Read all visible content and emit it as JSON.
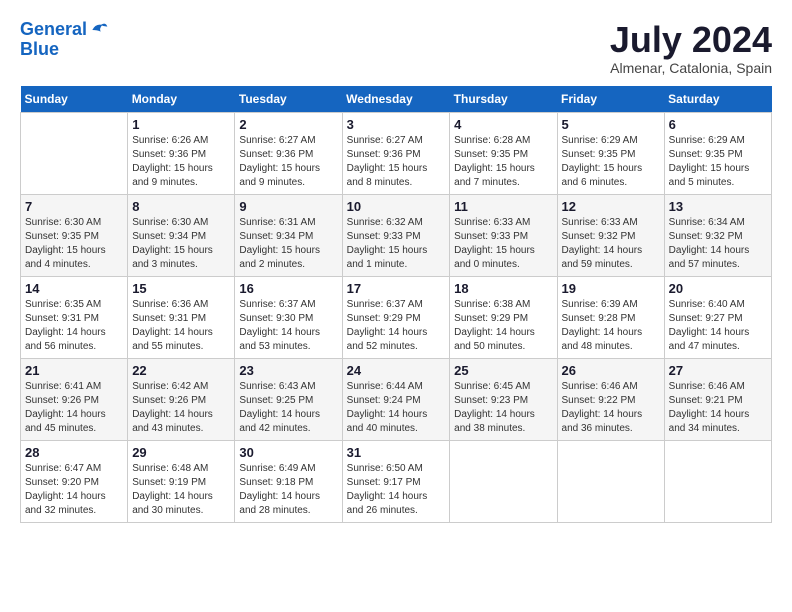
{
  "header": {
    "logo_line1": "General",
    "logo_line2": "Blue",
    "month_year": "July 2024",
    "location": "Almenar, Catalonia, Spain"
  },
  "days_of_week": [
    "Sunday",
    "Monday",
    "Tuesday",
    "Wednesday",
    "Thursday",
    "Friday",
    "Saturday"
  ],
  "weeks": [
    [
      {
        "day": "",
        "info": ""
      },
      {
        "day": "1",
        "info": "Sunrise: 6:26 AM\nSunset: 9:36 PM\nDaylight: 15 hours\nand 9 minutes."
      },
      {
        "day": "2",
        "info": "Sunrise: 6:27 AM\nSunset: 9:36 PM\nDaylight: 15 hours\nand 9 minutes."
      },
      {
        "day": "3",
        "info": "Sunrise: 6:27 AM\nSunset: 9:36 PM\nDaylight: 15 hours\nand 8 minutes."
      },
      {
        "day": "4",
        "info": "Sunrise: 6:28 AM\nSunset: 9:35 PM\nDaylight: 15 hours\nand 7 minutes."
      },
      {
        "day": "5",
        "info": "Sunrise: 6:29 AM\nSunset: 9:35 PM\nDaylight: 15 hours\nand 6 minutes."
      },
      {
        "day": "6",
        "info": "Sunrise: 6:29 AM\nSunset: 9:35 PM\nDaylight: 15 hours\nand 5 minutes."
      }
    ],
    [
      {
        "day": "7",
        "info": "Sunrise: 6:30 AM\nSunset: 9:35 PM\nDaylight: 15 hours\nand 4 minutes."
      },
      {
        "day": "8",
        "info": "Sunrise: 6:30 AM\nSunset: 9:34 PM\nDaylight: 15 hours\nand 3 minutes."
      },
      {
        "day": "9",
        "info": "Sunrise: 6:31 AM\nSunset: 9:34 PM\nDaylight: 15 hours\nand 2 minutes."
      },
      {
        "day": "10",
        "info": "Sunrise: 6:32 AM\nSunset: 9:33 PM\nDaylight: 15 hours\nand 1 minute."
      },
      {
        "day": "11",
        "info": "Sunrise: 6:33 AM\nSunset: 9:33 PM\nDaylight: 15 hours\nand 0 minutes."
      },
      {
        "day": "12",
        "info": "Sunrise: 6:33 AM\nSunset: 9:32 PM\nDaylight: 14 hours\nand 59 minutes."
      },
      {
        "day": "13",
        "info": "Sunrise: 6:34 AM\nSunset: 9:32 PM\nDaylight: 14 hours\nand 57 minutes."
      }
    ],
    [
      {
        "day": "14",
        "info": "Sunrise: 6:35 AM\nSunset: 9:31 PM\nDaylight: 14 hours\nand 56 minutes."
      },
      {
        "day": "15",
        "info": "Sunrise: 6:36 AM\nSunset: 9:31 PM\nDaylight: 14 hours\nand 55 minutes."
      },
      {
        "day": "16",
        "info": "Sunrise: 6:37 AM\nSunset: 9:30 PM\nDaylight: 14 hours\nand 53 minutes."
      },
      {
        "day": "17",
        "info": "Sunrise: 6:37 AM\nSunset: 9:29 PM\nDaylight: 14 hours\nand 52 minutes."
      },
      {
        "day": "18",
        "info": "Sunrise: 6:38 AM\nSunset: 9:29 PM\nDaylight: 14 hours\nand 50 minutes."
      },
      {
        "day": "19",
        "info": "Sunrise: 6:39 AM\nSunset: 9:28 PM\nDaylight: 14 hours\nand 48 minutes."
      },
      {
        "day": "20",
        "info": "Sunrise: 6:40 AM\nSunset: 9:27 PM\nDaylight: 14 hours\nand 47 minutes."
      }
    ],
    [
      {
        "day": "21",
        "info": "Sunrise: 6:41 AM\nSunset: 9:26 PM\nDaylight: 14 hours\nand 45 minutes."
      },
      {
        "day": "22",
        "info": "Sunrise: 6:42 AM\nSunset: 9:26 PM\nDaylight: 14 hours\nand 43 minutes."
      },
      {
        "day": "23",
        "info": "Sunrise: 6:43 AM\nSunset: 9:25 PM\nDaylight: 14 hours\nand 42 minutes."
      },
      {
        "day": "24",
        "info": "Sunrise: 6:44 AM\nSunset: 9:24 PM\nDaylight: 14 hours\nand 40 minutes."
      },
      {
        "day": "25",
        "info": "Sunrise: 6:45 AM\nSunset: 9:23 PM\nDaylight: 14 hours\nand 38 minutes."
      },
      {
        "day": "26",
        "info": "Sunrise: 6:46 AM\nSunset: 9:22 PM\nDaylight: 14 hours\nand 36 minutes."
      },
      {
        "day": "27",
        "info": "Sunrise: 6:46 AM\nSunset: 9:21 PM\nDaylight: 14 hours\nand 34 minutes."
      }
    ],
    [
      {
        "day": "28",
        "info": "Sunrise: 6:47 AM\nSunset: 9:20 PM\nDaylight: 14 hours\nand 32 minutes."
      },
      {
        "day": "29",
        "info": "Sunrise: 6:48 AM\nSunset: 9:19 PM\nDaylight: 14 hours\nand 30 minutes."
      },
      {
        "day": "30",
        "info": "Sunrise: 6:49 AM\nSunset: 9:18 PM\nDaylight: 14 hours\nand 28 minutes."
      },
      {
        "day": "31",
        "info": "Sunrise: 6:50 AM\nSunset: 9:17 PM\nDaylight: 14 hours\nand 26 minutes."
      },
      {
        "day": "",
        "info": ""
      },
      {
        "day": "",
        "info": ""
      },
      {
        "day": "",
        "info": ""
      }
    ]
  ]
}
